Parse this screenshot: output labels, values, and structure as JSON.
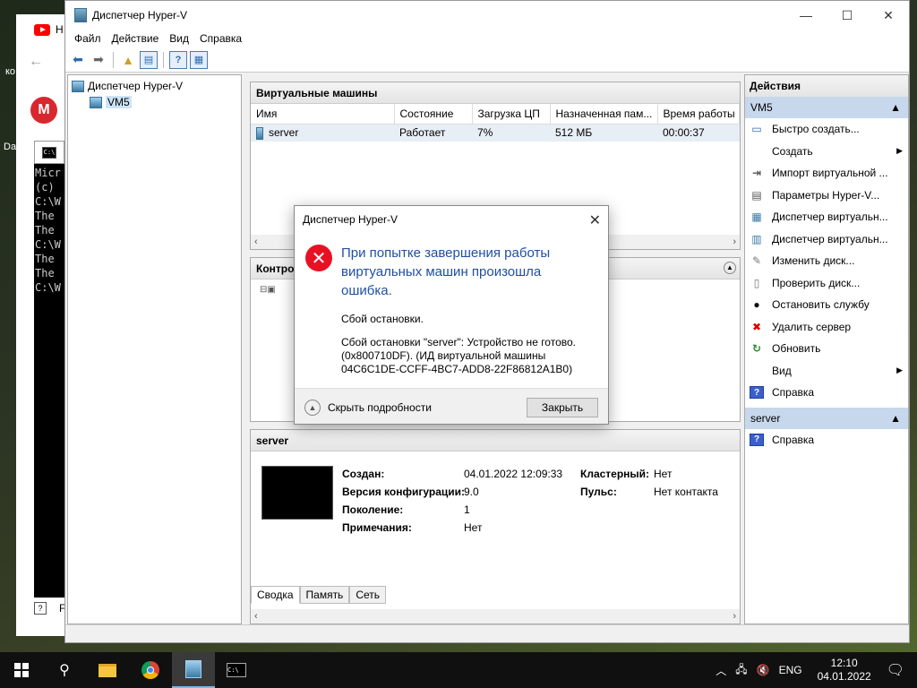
{
  "background": {
    "browser_tab": "Н",
    "left_texts": [
      "ко",
      "Da"
    ],
    "mega_letter": "M",
    "cmd_lines": [
      "Micr",
      "(c)",
      "",
      "C:\\W",
      "The",
      "The",
      "",
      "",
      "C:\\W",
      "The",
      "The",
      "",
      "",
      "C:\\W"
    ],
    "bottom_label": "F"
  },
  "window": {
    "title": "Диспетчер Hyper-V",
    "menu": [
      "Файл",
      "Действие",
      "Вид",
      "Справка"
    ]
  },
  "tree": {
    "root": "Диспетчер Hyper-V",
    "host": "VM5"
  },
  "vms": {
    "header": "Виртуальные машины",
    "columns": [
      "Имя",
      "Состояние",
      "Загрузка ЦП",
      "Назначенная пам...",
      "Время работы"
    ],
    "rows": [
      {
        "name": "server",
        "state": "Работает",
        "cpu": "7%",
        "memory": "512 МБ",
        "uptime": "00:00:37"
      }
    ]
  },
  "checkpoints": {
    "header": "Контро"
  },
  "details": {
    "header": "server",
    "created_label": "Создан:",
    "created_value": "04.01.2022 12:09:33",
    "config_label": "Версия конфигурации:",
    "config_value": "9.0",
    "gen_label": "Поколение:",
    "gen_value": "1",
    "notes_label": "Примечания:",
    "notes_value": "Нет",
    "cluster_label": "Кластерный:",
    "cluster_value": "Нет",
    "heartbeat_label": "Пульс:",
    "heartbeat_value": "Нет контакта",
    "tabs": [
      "Сводка",
      "Память",
      "Сеть"
    ]
  },
  "actions": {
    "header": "Действия",
    "host_section": "VM5",
    "host_items": [
      {
        "label": "Быстро создать...",
        "icon": "quick-create-icon"
      },
      {
        "label": "Создать",
        "icon": "blank",
        "submenu": true
      },
      {
        "label": "Импорт виртуальной ...",
        "icon": "import-icon"
      },
      {
        "label": "Параметры Hyper-V...",
        "icon": "settings-icon"
      },
      {
        "label": "Диспетчер виртуальн...",
        "icon": "switch-manager-icon"
      },
      {
        "label": "Диспетчер виртуальн...",
        "icon": "san-manager-icon"
      },
      {
        "label": "Изменить диск...",
        "icon": "edit-disk-icon"
      },
      {
        "label": "Проверить диск...",
        "icon": "inspect-disk-icon"
      },
      {
        "label": "Остановить службу",
        "icon": "stop-service-icon"
      },
      {
        "label": "Удалить сервер",
        "icon": "remove-server-icon"
      },
      {
        "label": "Обновить",
        "icon": "refresh-icon"
      },
      {
        "label": "Вид",
        "icon": "blank",
        "submenu": true
      },
      {
        "label": "Справка",
        "icon": "help-icon"
      }
    ],
    "vm_section": "server",
    "vm_items": [
      {
        "label": "Справка",
        "icon": "help-icon"
      }
    ]
  },
  "dialog": {
    "title": "Диспетчер Hyper-V",
    "main": "При попытке завершения работы виртуальных машин произошла ошибка.",
    "sub": "Сбой остановки.",
    "details": "Сбой остановки \"server\": Устройство не готово. (0x800710DF). (ИД виртуальной машины 04C6C1DE-CCFF-4BC7-ADD8-22F86812A1B0)",
    "toggle": "Скрыть подробности",
    "close": "Закрыть"
  },
  "taskbar": {
    "language": "ENG",
    "time": "12:10",
    "date": "04.01.2022"
  }
}
